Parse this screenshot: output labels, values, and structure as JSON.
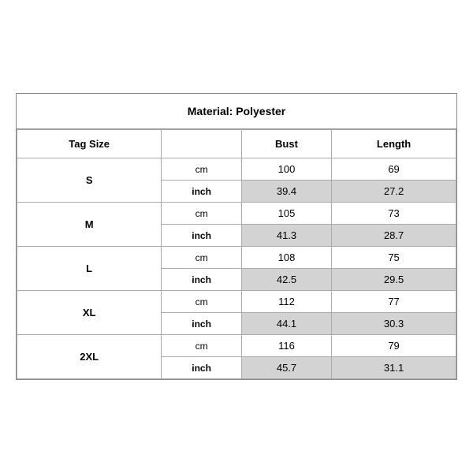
{
  "title": "Material: Polyester",
  "headers": {
    "tag_size": "Tag Size",
    "bust": "Bust",
    "length": "Length"
  },
  "sizes": [
    {
      "size": "S",
      "cm": {
        "bust": "100",
        "length": "69"
      },
      "inch": {
        "bust": "39.4",
        "length": "27.2"
      }
    },
    {
      "size": "M",
      "cm": {
        "bust": "105",
        "length": "73"
      },
      "inch": {
        "bust": "41.3",
        "length": "28.7"
      }
    },
    {
      "size": "L",
      "cm": {
        "bust": "108",
        "length": "75"
      },
      "inch": {
        "bust": "42.5",
        "length": "29.5"
      }
    },
    {
      "size": "XL",
      "cm": {
        "bust": "112",
        "length": "77"
      },
      "inch": {
        "bust": "44.1",
        "length": "30.3"
      }
    },
    {
      "size": "2XL",
      "cm": {
        "bust": "116",
        "length": "79"
      },
      "inch": {
        "bust": "45.7",
        "length": "31.1"
      }
    }
  ],
  "units": {
    "cm": "cm",
    "inch": "inch"
  }
}
